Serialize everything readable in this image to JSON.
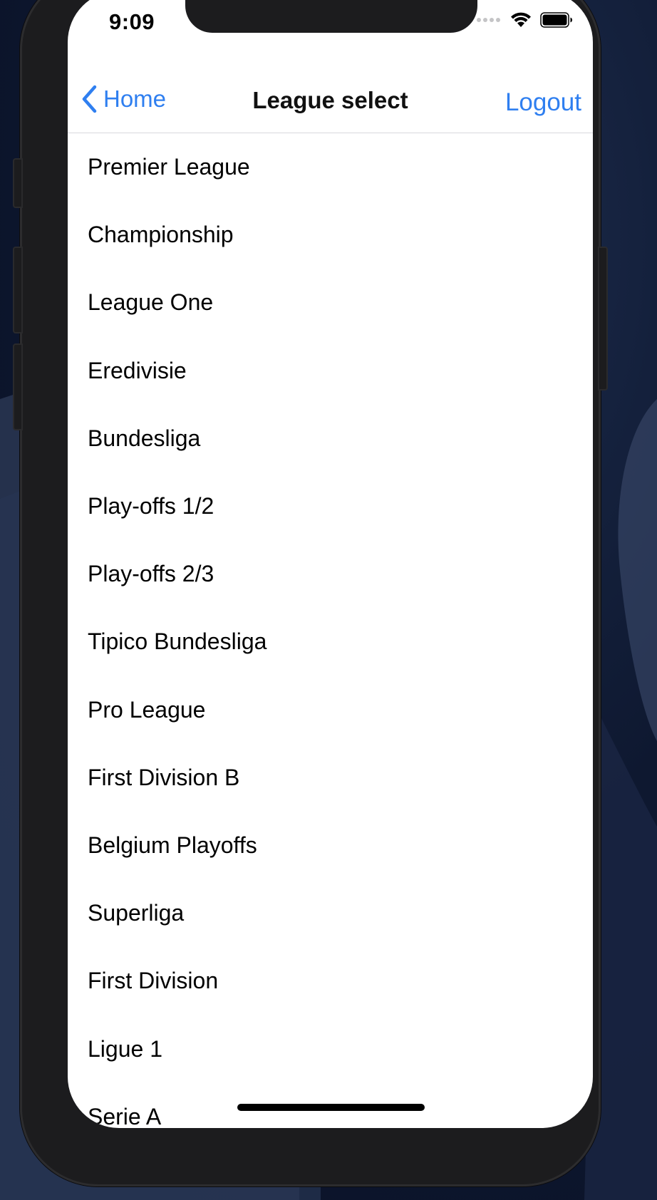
{
  "status_bar": {
    "time": "9:09"
  },
  "nav": {
    "back_label": "Home",
    "title": "League select",
    "logout_label": "Logout"
  },
  "leagues": [
    "Premier League",
    "Championship",
    "League One",
    "Eredivisie",
    "Bundesliga",
    "Play-offs 1/2",
    "Play-offs 2/3",
    "Tipico Bundesliga",
    "Pro League",
    "First Division B",
    "Belgium Playoffs",
    "Superliga",
    "First Division",
    "Ligue 1",
    "Serie A"
  ],
  "colors": {
    "accent": "#2f7ff0",
    "background": "#ffffff",
    "text": "#000000"
  },
  "icons": {
    "back": "chevron-left-icon",
    "cellular": "cellular-signal-icon",
    "wifi": "wifi-icon",
    "battery": "battery-icon"
  }
}
